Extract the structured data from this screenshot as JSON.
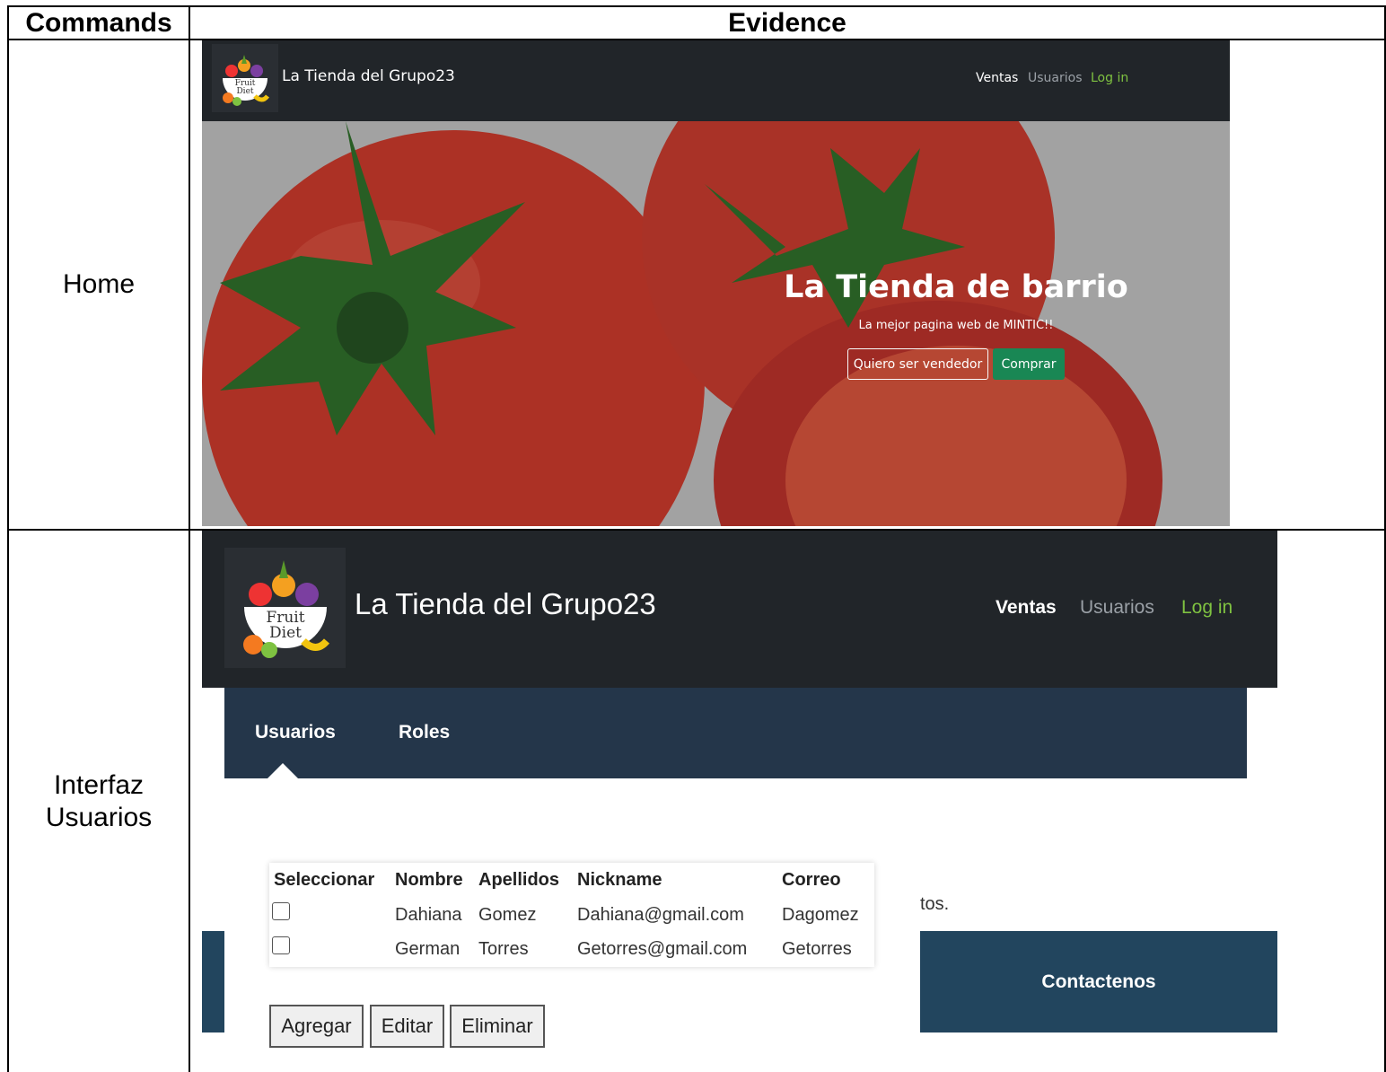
{
  "table_headers": {
    "commands": "Commands",
    "evidence": "Evidence"
  },
  "rows": [
    {
      "command": "Home"
    },
    {
      "command": "Interfaz\nUsuarios"
    }
  ],
  "home": {
    "brand": "La Tienda del Grupo23",
    "logo_text": "Fruit Diet",
    "nav": {
      "ventas": "Ventas",
      "usuarios": "Usuarios",
      "login": "Log in"
    },
    "hero_title": "La Tienda de barrio",
    "hero_subtitle": "La mejor pagina web de MINTIC!!",
    "btn_vendedor": "Quiero ser vendedor",
    "btn_comprar": "Comprar"
  },
  "usuarios": {
    "brand": "La Tienda del Grupo23",
    "logo_text": "Fruit Diet",
    "nav": {
      "ventas": "Ventas",
      "usuarios": "Usuarios",
      "login": "Log in"
    },
    "tabs": {
      "usuarios": "Usuarios",
      "roles": "Roles"
    },
    "columns": [
      "Seleccionar",
      "Nombre",
      "Apellidos",
      "Nickname",
      "Correo"
    ],
    "users": [
      {
        "nombre": "Dahiana",
        "apellidos": "Gomez",
        "nickname": "Dahiana@gmail.com",
        "correo": "Dagomez"
      },
      {
        "nombre": "German",
        "apellidos": "Torres",
        "nickname": "Getorres@gmail.com",
        "correo": "Getorres"
      }
    ],
    "partial_text": "tos.",
    "buttons": {
      "agregar": "Agregar",
      "editar": "Editar",
      "eliminar": "Eliminar"
    },
    "contact": "Contactenos"
  },
  "colors": {
    "navbar": "#212529",
    "tabbar": "#24364a",
    "login_green": "#7fc241",
    "comprar_green": "#198754",
    "contact": "#22455e"
  }
}
